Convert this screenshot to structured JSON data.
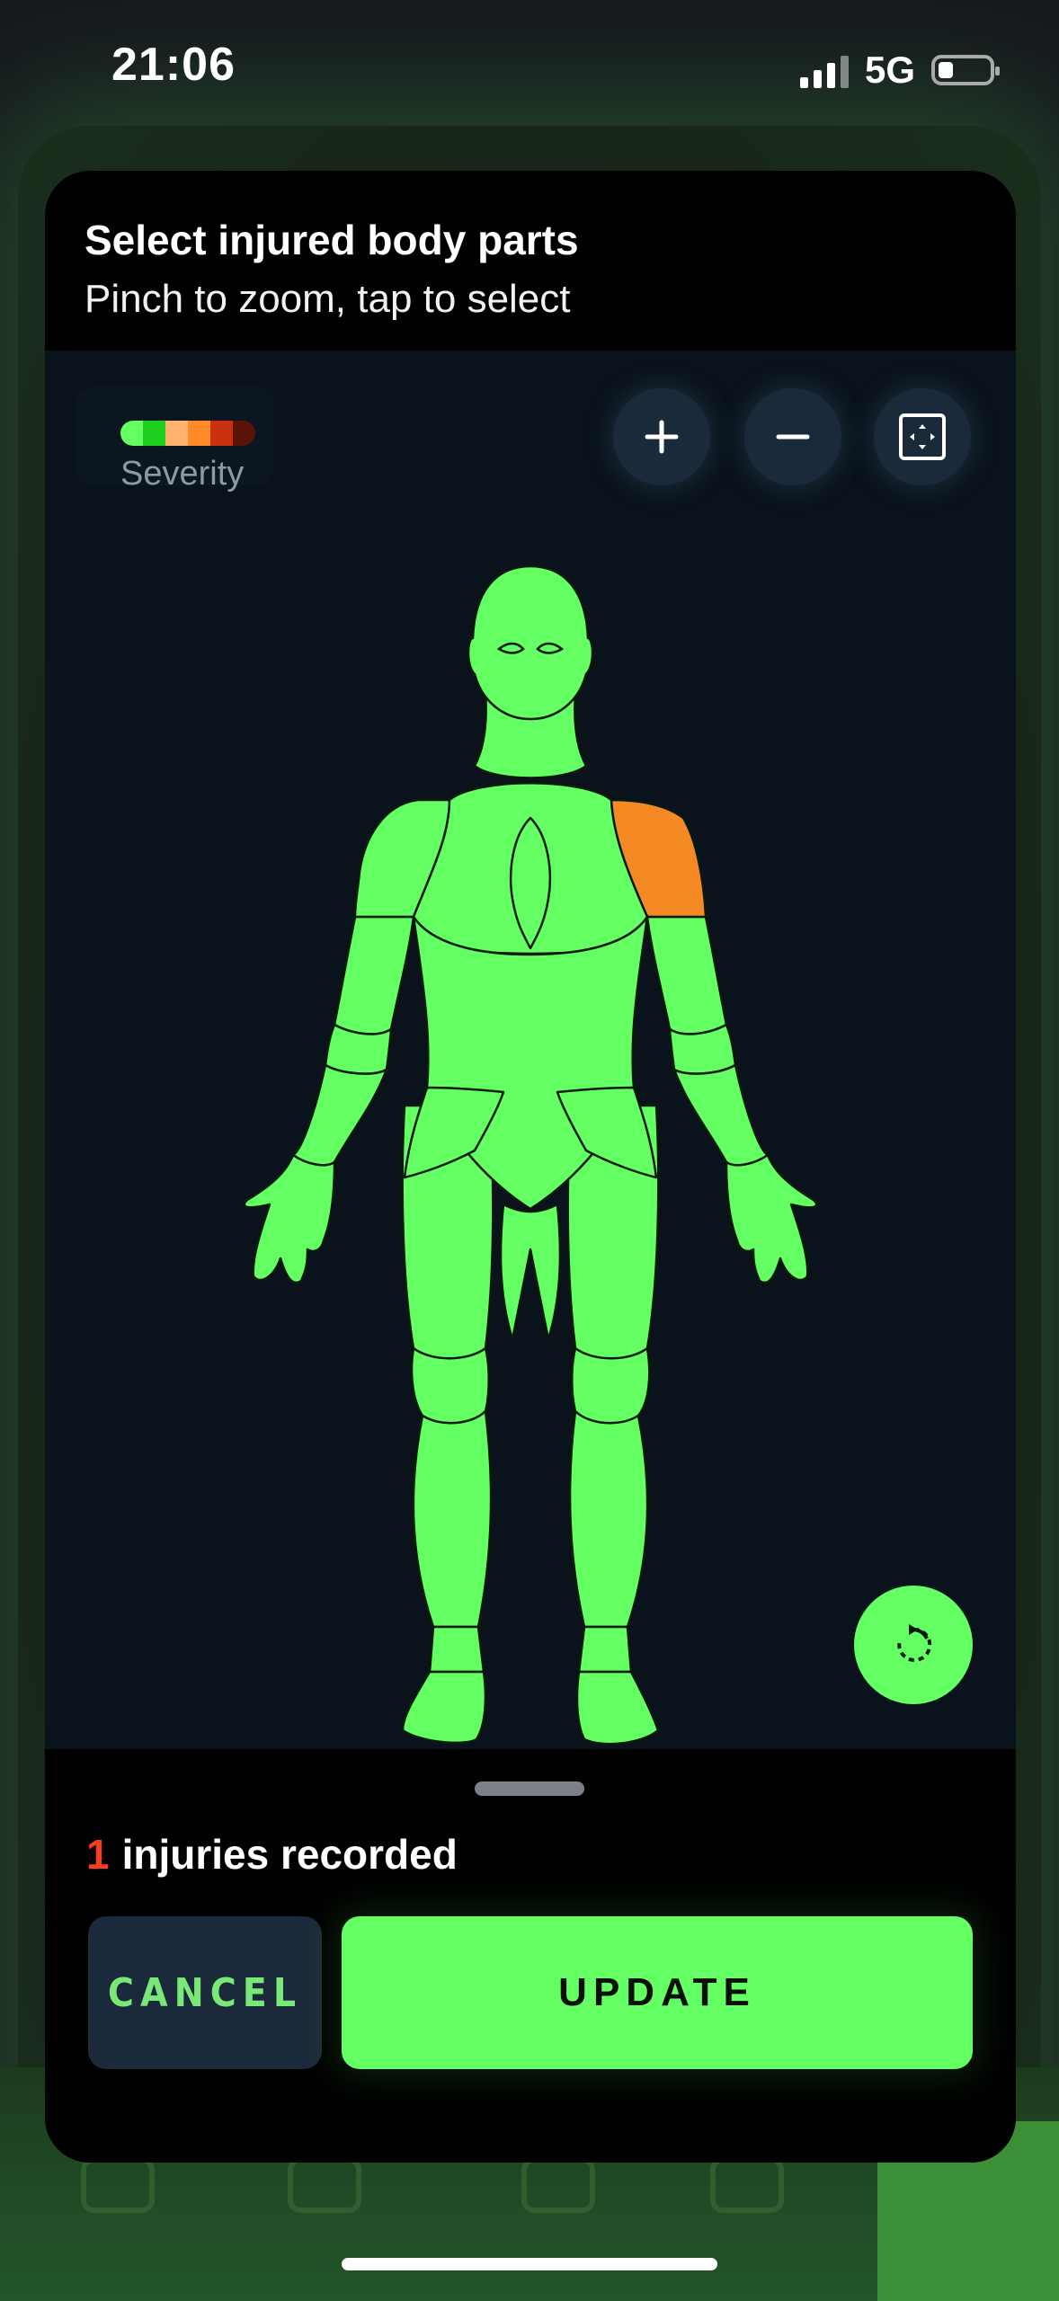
{
  "status_bar": {
    "time": "21:06",
    "network": "5G",
    "battery_icon": "battery-low-icon",
    "signal_icon": "cellular-signal-icon"
  },
  "header": {
    "title": "Select injured body parts",
    "subtitle": "Pinch to zoom, tap to select"
  },
  "legend": {
    "label": "Severity",
    "colors": [
      "#63ff63",
      "#1fd11f",
      "#ffb46e",
      "#ff8a2a",
      "#c8300f",
      "#5a1407"
    ]
  },
  "controls": {
    "zoom_in_icon": "plus-icon",
    "zoom_out_icon": "minus-icon",
    "fit_icon": "fit-to-screen-icon",
    "rotate_icon": "rotate-icon"
  },
  "body_map": {
    "base_color": "#63ff63",
    "selected_parts": [
      {
        "part": "left-shoulder",
        "color": "#f58a24"
      }
    ]
  },
  "footer": {
    "injury_count": "1",
    "injury_text": "injuries recorded",
    "cancel_label": "CANCEL",
    "update_label": "UPDATE"
  },
  "colors": {
    "accent": "#63ff63",
    "sheet_bg": "#000000",
    "canvas_bg": "#0a131c",
    "danger_count": "#ff3b1f"
  }
}
